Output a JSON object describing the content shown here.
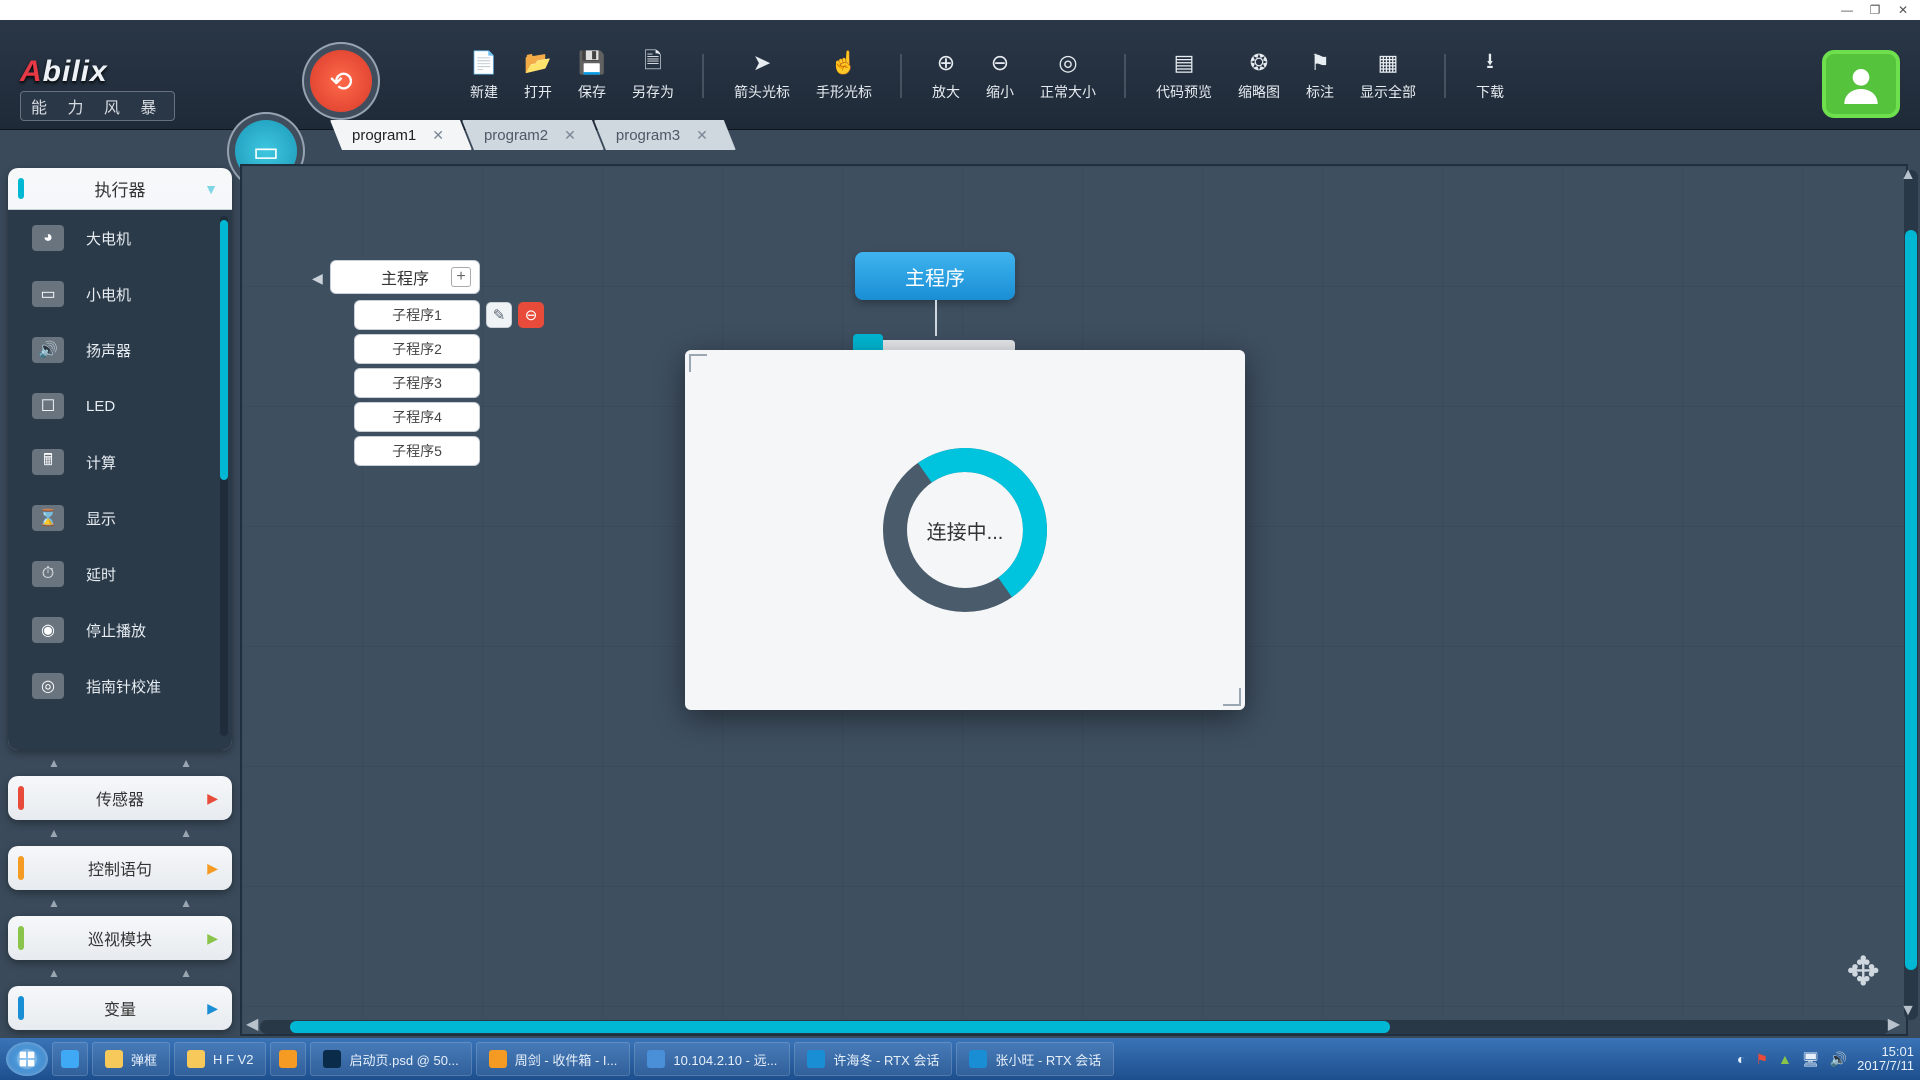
{
  "logo": {
    "name": "Abilix",
    "sub": "能 力 风 暴"
  },
  "toolbar": {
    "new": "新建",
    "open": "打开",
    "save": "保存",
    "saveas": "另存为",
    "arrow": "箭头光标",
    "hand": "手形光标",
    "zoomin": "放大",
    "zoomout": "缩小",
    "zoom100": "正常大小",
    "codepv": "代码预览",
    "thumb": "缩略图",
    "annot": "标注",
    "showall": "显示全部",
    "download": "下载"
  },
  "tabs": [
    {
      "label": "program1",
      "active": true
    },
    {
      "label": "program2",
      "active": false
    },
    {
      "label": "program3",
      "active": false
    }
  ],
  "program_tree": {
    "main": "主程序",
    "subs": [
      "子程序1",
      "子程序2",
      "子程序3",
      "子程序4",
      "子程序5"
    ]
  },
  "canvas_main_block": "主程序",
  "modal_text": "连接中...",
  "sidebar": {
    "cat_actuator": "执行器",
    "blocks": [
      "大电机",
      "小电机",
      "扬声器",
      "LED",
      "计算",
      "显示",
      "延时",
      "停止播放",
      "指南针校准"
    ],
    "cat_sensor": "传感器",
    "cat_control": "控制语句",
    "cat_patrol": "巡视模块",
    "cat_var": "变量"
  },
  "taskbar": {
    "items": [
      {
        "icon": "ie",
        "label": ""
      },
      {
        "icon": "folder",
        "label": "弹框"
      },
      {
        "icon": "folder",
        "label": "H F  V2"
      },
      {
        "icon": "media",
        "label": ""
      },
      {
        "icon": "ps",
        "label": "启动页.psd @ 50..."
      },
      {
        "icon": "mail",
        "label": "周剑 - 收件箱 - I..."
      },
      {
        "icon": "remote",
        "label": "10.104.2.10 - 远..."
      },
      {
        "icon": "rtx",
        "label": "许海冬 - RTX 会话"
      },
      {
        "icon": "rtx",
        "label": "张小旺 - RTX 会话"
      }
    ],
    "time": "15:01",
    "date": "2017/7/11"
  },
  "colors": {
    "sensor": "#e84b3a",
    "control": "#f59a23",
    "patrol": "#8ac44b",
    "var": "#1a8ed4",
    "actuator": "#00b8d4"
  }
}
